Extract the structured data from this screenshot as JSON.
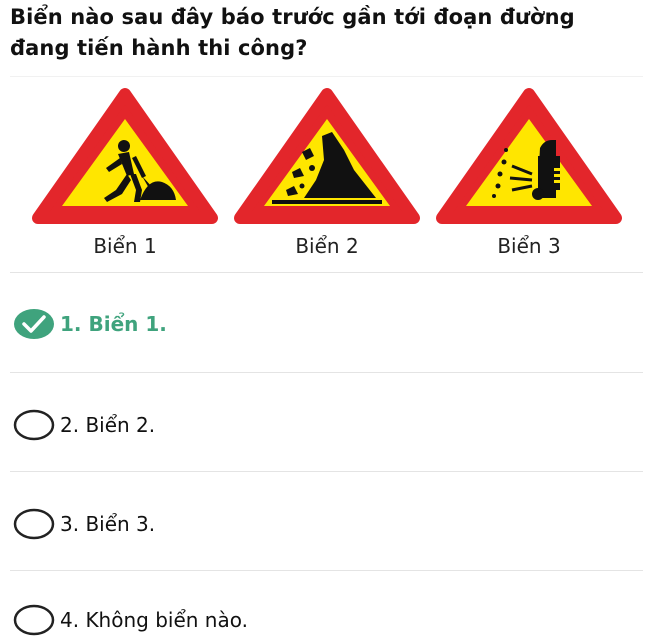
{
  "question": {
    "text": "Biển nào sau đây báo trước gần tới đoạn đường đang tiến hành thi công?"
  },
  "signs": [
    {
      "caption": "Biển 1",
      "icon": "road-works-sign"
    },
    {
      "caption": "Biển 2",
      "icon": "falling-rocks-sign"
    },
    {
      "caption": "Biển 3",
      "icon": "loose-gravel-sign"
    }
  ],
  "options": [
    {
      "label": "1. Biển 1.",
      "selected": true
    },
    {
      "label": "2. Biển 2.",
      "selected": false
    },
    {
      "label": "3. Biển 3.",
      "selected": false
    },
    {
      "label": "4. Không biển nào.",
      "selected": false
    }
  ],
  "colors": {
    "sign_border": "#e3262b",
    "sign_fill": "#ffe600",
    "selected_accent": "#3fa37d",
    "radio_outline": "#222222"
  }
}
